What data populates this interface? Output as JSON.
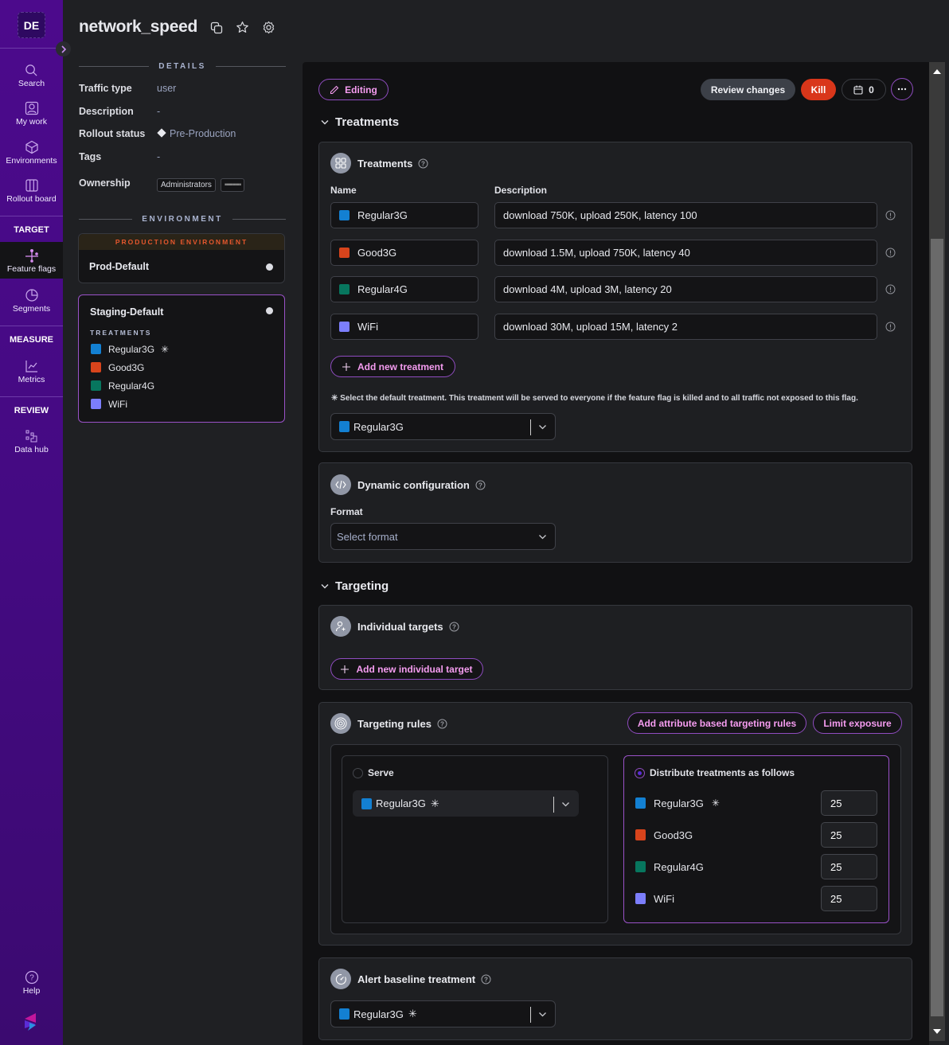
{
  "nav": {
    "avatar": "DE",
    "items": [
      {
        "label": "Search",
        "icon": "search-icon"
      },
      {
        "label": "My work",
        "icon": "user-card-icon"
      },
      {
        "label": "Environments",
        "icon": "cube-icon"
      },
      {
        "label": "Rollout board",
        "icon": "columns-icon"
      }
    ],
    "sections": {
      "target": "TARGET",
      "measure": "MEASURE",
      "review": "REVIEW"
    },
    "target_items": [
      {
        "label": "Feature flags",
        "icon": "feature-flag-icon",
        "active": true
      },
      {
        "label": "Segments",
        "icon": "pie-icon"
      }
    ],
    "measure_items": [
      {
        "label": "Metrics",
        "icon": "line-chart-icon"
      }
    ],
    "review_items": [
      {
        "label": "Data hub",
        "icon": "data-hub-icon"
      }
    ],
    "help": "Help"
  },
  "header": {
    "title": "network_speed",
    "icons": [
      "copy-icon",
      "star-icon",
      "gear-icon"
    ]
  },
  "details": {
    "heading": "DETAILS",
    "traffic_type_label": "Traffic type",
    "traffic_type": "user",
    "description_label": "Description",
    "description": "-",
    "rollout_status_label": "Rollout status",
    "rollout_status": "Pre-Production",
    "tags_label": "Tags",
    "tags": "-",
    "ownership_label": "Ownership",
    "owners": [
      "Administrators",
      "▪▪▪▪▪▪▪▪"
    ]
  },
  "environment": {
    "heading": "ENVIRONMENT",
    "production_banner": "PRODUCTION ENVIRONMENT",
    "prod_name": "Prod-Default",
    "staging_name": "Staging-Default",
    "treatments_label": "TREATMENTS"
  },
  "treatments": [
    {
      "name": "Regular3G",
      "color": "#1380d2",
      "description": "download 750K, upload 250K, latency 100",
      "default": true,
      "percent": "25"
    },
    {
      "name": "Good3G",
      "color": "#d8441c",
      "description": "download 1.5M, upload 750K, latency 40",
      "default": false,
      "percent": "25"
    },
    {
      "name": "Regular4G",
      "color": "#07765e",
      "description": "download 4M, upload 3M, latency 20",
      "default": false,
      "percent": "25"
    },
    {
      "name": "WiFi",
      "color": "#7c7efc",
      "description": "download 30M, upload 15M, latency 2",
      "default": false,
      "percent": "25"
    }
  ],
  "toolbar": {
    "editing": "Editing",
    "review_changes": "Review changes",
    "kill": "Kill",
    "calendar_count": "0"
  },
  "treatments_section": {
    "heading": "Treatments",
    "card_title": "Treatments",
    "name_col": "Name",
    "description_col": "Description",
    "add_button": "Add new treatment",
    "default_note": "✳ Select the default treatment. This treatment will be served to everyone if the feature flag is killed and to all traffic not exposed to this flag.",
    "default_value": "Regular3G"
  },
  "dynamic_config": {
    "title": "Dynamic configuration",
    "format_label": "Format",
    "format_placeholder": "Select format"
  },
  "targeting": {
    "heading": "Targeting",
    "individual_title": "Individual targets",
    "add_individual": "Add new individual target",
    "rules_title": "Targeting rules",
    "add_attribute_rules": "Add attribute based targeting rules",
    "limit_exposure": "Limit exposure",
    "serve_label": "Serve",
    "serve_value": "Regular3G",
    "distribute_label": "Distribute treatments as follows",
    "distribute_selected": true
  },
  "alert_baseline": {
    "title": "Alert baseline treatment",
    "value": "Regular3G"
  },
  "default_marker": "✳"
}
